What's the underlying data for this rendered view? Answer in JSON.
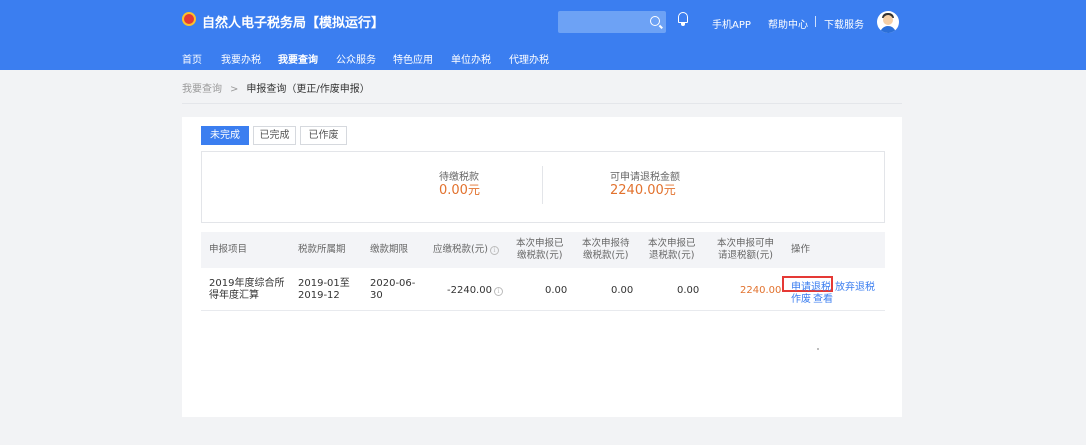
{
  "header": {
    "site_title": "自然人电子税务局【模拟运行】",
    "search_placeholder": "",
    "links": {
      "mobile_app": "手机APP",
      "help_center": "帮助中心",
      "download_service": "下载服务"
    },
    "separator": "|"
  },
  "nav": {
    "items": [
      {
        "label": "首页"
      },
      {
        "label": "我要办税"
      },
      {
        "label": "我要查询"
      },
      {
        "label": "公众服务"
      },
      {
        "label": "特色应用"
      },
      {
        "label": "单位办税"
      },
      {
        "label": "代理办税"
      }
    ],
    "active_index": 2
  },
  "breadcrumb": {
    "parent": "我要查询",
    "separator": ">",
    "current": "申报查询（更正/作废申报）"
  },
  "tabs": [
    {
      "label": "未完成",
      "active": true
    },
    {
      "label": "已完成",
      "active": false
    },
    {
      "label": "已作废",
      "active": false
    }
  ],
  "summary": {
    "tax_due_label": "待缴税款",
    "tax_due_value": "0.00",
    "tax_due_unit": "元",
    "refund_label": "可申请退税金额",
    "refund_value": "2240.00",
    "refund_unit": "元"
  },
  "table": {
    "columns": [
      {
        "label_1": "申报项目",
        "label_2": ""
      },
      {
        "label_1": "税款所属期",
        "label_2": ""
      },
      {
        "label_1": "缴款期限",
        "label_2": ""
      },
      {
        "label_1": "应缴税款(元)",
        "label_2": ""
      },
      {
        "label_1": "本次申报已",
        "label_2": "缴税款(元)"
      },
      {
        "label_1": "本次申报待",
        "label_2": "缴税款(元)"
      },
      {
        "label_1": "本次申报已",
        "label_2": "退税款(元)"
      },
      {
        "label_1": "本次申报可申",
        "label_2": "请退税额(元)"
      },
      {
        "label_1": "操作",
        "label_2": ""
      }
    ],
    "rows": [
      {
        "item_1": "2019年度综合所",
        "item_2": "得年度汇算",
        "period_1": "2019-01至",
        "period_2": "2019-12",
        "deadline_1": "2020-06-",
        "deadline_2": "30",
        "tax_payable": "-2240.00",
        "paid": "0.00",
        "to_pay": "0.00",
        "refunded": "0.00",
        "refundable": "2240.00",
        "actions": {
          "apply_refund": "申请退税",
          "give_up_refund": "放弃退税",
          "void": "作废",
          "view": "查看"
        }
      }
    ]
  },
  "info_icon_glyph": "i",
  "colors": {
    "brand_blue": "#3b7ef0",
    "amount_orange": "#e2722e",
    "highlight_red": "#e53935"
  }
}
